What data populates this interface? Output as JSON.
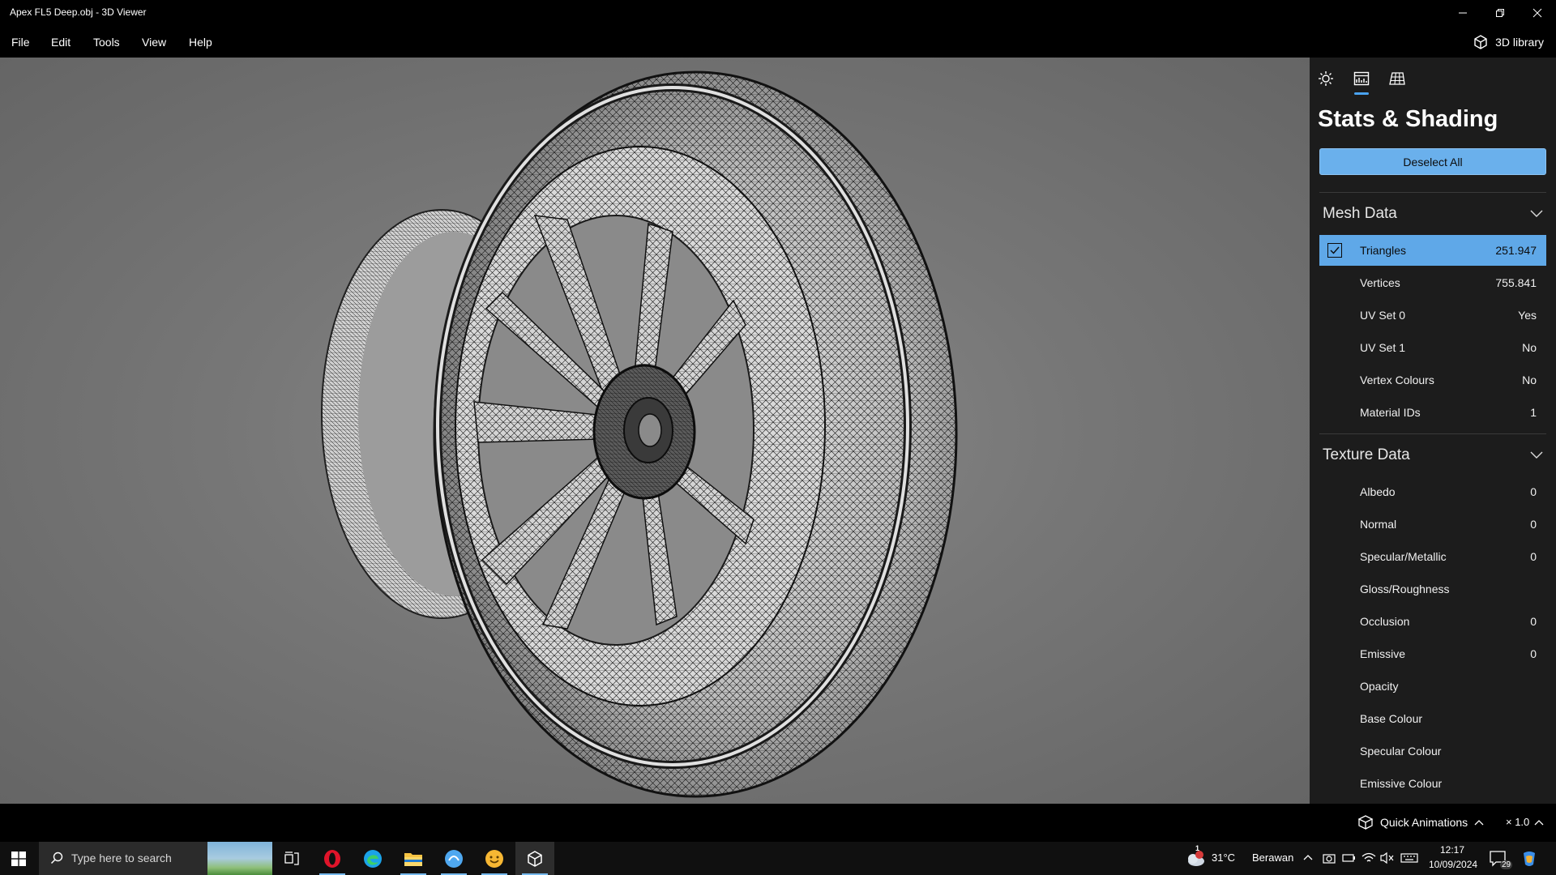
{
  "window": {
    "title": "Apex FL5 Deep.obj - 3D Viewer",
    "minimize_icon": "minimize-icon",
    "restore_icon": "restore-icon",
    "close_icon": "close-icon"
  },
  "menu": {
    "items": [
      "File",
      "Edit",
      "Tools",
      "View",
      "Help"
    ],
    "library_label": "3D library"
  },
  "panel": {
    "tabs": [
      "lighting-tab",
      "stats-tab",
      "grid-tab"
    ],
    "active_tab": "stats-tab",
    "title": "Stats & Shading",
    "deselect_label": "Deselect All",
    "mesh_section": {
      "title": "Mesh Data",
      "rows": [
        {
          "label": "Triangles",
          "value": "251.947",
          "selected": true
        },
        {
          "label": "Vertices",
          "value": "755.841"
        },
        {
          "label": "UV Set 0",
          "value": "Yes"
        },
        {
          "label": "UV Set 1",
          "value": "No"
        },
        {
          "label": "Vertex Colours",
          "value": "No"
        },
        {
          "label": "Material IDs",
          "value": "1"
        }
      ]
    },
    "texture_section": {
      "title": "Texture Data",
      "rows": [
        {
          "label": "Albedo",
          "value": "0"
        },
        {
          "label": "Normal",
          "value": "0"
        },
        {
          "label": "Specular/Metallic",
          "value": "0"
        },
        {
          "label": "Gloss/Roughness",
          "value": ""
        },
        {
          "label": "Occlusion",
          "value": "0"
        },
        {
          "label": "Emissive",
          "value": "0"
        },
        {
          "label": "Opacity",
          "value": ""
        },
        {
          "label": "Base Colour",
          "value": ""
        },
        {
          "label": "Specular Colour",
          "value": ""
        },
        {
          "label": "Emissive Colour",
          "value": ""
        }
      ]
    }
  },
  "bottom": {
    "quick_animations": "Quick Animations",
    "speed": "× 1.0"
  },
  "taskbar": {
    "search_placeholder": "Type here to search",
    "weather_temp": "31°C",
    "weather_desc": "Berawan",
    "weather_alert": "1",
    "time": "12:17",
    "date": "10/09/2024",
    "notifications": "29"
  },
  "colors": {
    "accent": "#5fa8e8",
    "panel_bg": "#1c1c1c",
    "viewport_bg": "#777777"
  }
}
